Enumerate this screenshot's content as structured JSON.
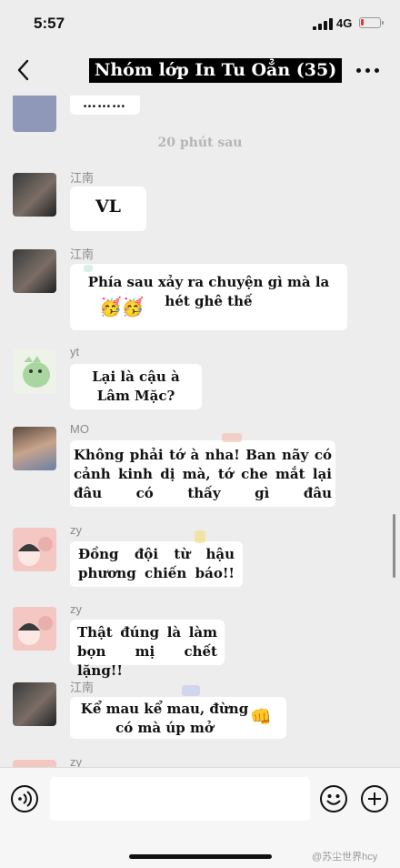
{
  "status_bar": {
    "time": "5:57",
    "network": "4G",
    "battery_level": 0.15,
    "battery_color": "#e53935"
  },
  "nav": {
    "back_icon": "chevron-left-icon",
    "title": "Nhóm lớp In Tu Oẳn (35)",
    "more_icon": "more-dots-icon"
  },
  "chat": {
    "partial_top_text": "………",
    "time_separator": "20 phút sau",
    "messages": [
      {
        "sender": "江南",
        "text": "VL"
      },
      {
        "sender": "江南",
        "text": "Phía sau xảy ra chuyện gì mà la hét ghê thế",
        "emoji": "🥳🥳"
      },
      {
        "sender": "yt",
        "text": "Lại là cậu à Lâm Mặc?"
      },
      {
        "sender": "MO",
        "text": "Không phải tớ à nha! Ban nãy có cảnh kinh dị mà, tớ che mắt lại đâu có thấy gì đâu"
      },
      {
        "sender": "zy",
        "text": "Đồng đội từ hậu phương chiến báo!!"
      },
      {
        "sender": "zy",
        "text": "Thật đúng là làm bọn mị chết lặng!!"
      },
      {
        "sender": "江南",
        "text": "Kể mau kể mau, đừng có mà úp mở",
        "emoji": "👊"
      },
      {
        "sender": "zy",
        "text": ""
      }
    ]
  },
  "input_bar": {
    "voice_icon": "voice-icon",
    "emoji_icon": "emoji-icon",
    "plus_icon": "plus-icon",
    "watermark": "@苏尘世界hcy"
  }
}
